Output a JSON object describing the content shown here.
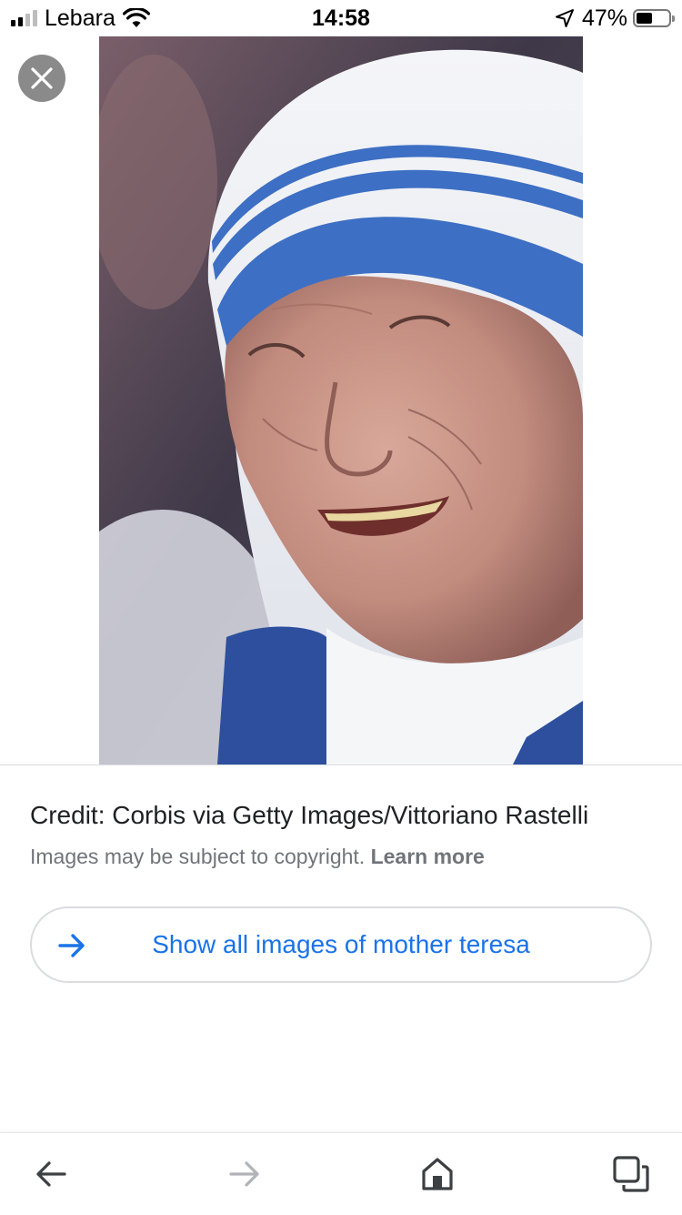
{
  "status_bar": {
    "carrier": "Lebara",
    "time": "14:58",
    "battery": "47%"
  },
  "image": {
    "subject": "photo",
    "colors": {
      "veil_stripe": "#3d6fc4",
      "veil": "#eef0f4"
    }
  },
  "credit": {
    "text": "Credit: Corbis via Getty Images/Vittoriano Rastelli",
    "copyright": "Images may be subject to copyright.",
    "learn_more": "Learn more"
  },
  "show_all": {
    "label": "Show all images of mother teresa",
    "icon": "arrow-right-icon"
  },
  "bottom_nav": {
    "items": [
      "back-icon",
      "forward-icon",
      "home-icon",
      "tabs-icon"
    ]
  },
  "colors": {
    "link": "#1a73e8",
    "muted": "#70757a",
    "border": "#dadce0"
  }
}
